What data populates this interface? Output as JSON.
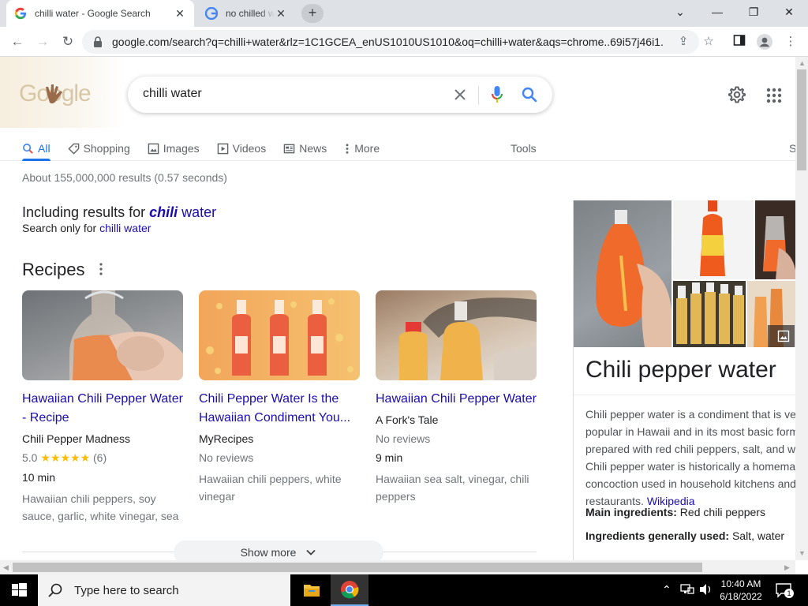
{
  "browser": {
    "tabs": [
      {
        "title": "chilli water - Google Search",
        "active": true
      },
      {
        "title": "no chilled water",
        "active": false
      }
    ],
    "url": "google.com/search?q=chilli+water&rlz=1C1GCEA_enUS1010US1010&oq=chilli+water&aqs=chrome..69i57j46i1..."
  },
  "header": {
    "doodle_text": "Google",
    "query": "chilli water"
  },
  "search_tabs": [
    {
      "label": "All",
      "icon": "search-icon",
      "active": true
    },
    {
      "label": "Shopping",
      "icon": "tag-icon",
      "active": false
    },
    {
      "label": "Images",
      "icon": "image-icon",
      "active": false
    },
    {
      "label": "Videos",
      "icon": "play-icon",
      "active": false
    },
    {
      "label": "News",
      "icon": "news-icon",
      "active": false
    },
    {
      "label": "More",
      "icon": "kebab-icon",
      "active": false
    }
  ],
  "tools_label": "Tools",
  "s_tab_label": "S",
  "result_stats": "About 155,000,000 results (0.57 seconds)",
  "spelling": {
    "prefix": "Including results for ",
    "corrected_bold": "chili",
    "corrected_rest": " water",
    "only_prefix": "Search only for ",
    "only_link": "chilli water"
  },
  "recipes": {
    "title": "Recipes",
    "cards": [
      {
        "title": "Hawaiian Chili Pepper Water - Recipe",
        "source": "Chili Pepper Madness",
        "rating": "5.0",
        "stars": "★★★★★",
        "reviews": "(6)",
        "time": "10 min",
        "ingredients": "Hawaiian chili peppers, soy sauce, garlic, white vinegar, sea"
      },
      {
        "title": "Chili Pepper Water Is the Hawaiian Condiment You...",
        "source": "MyRecipes",
        "rating_text": "No reviews",
        "ingredients": "Hawaiian chili peppers, white vinegar"
      },
      {
        "title": "Hawaiian Chili Pepper Water",
        "source": "A Fork's Tale",
        "rating_text": "No reviews",
        "time": "9 min",
        "ingredients": "Hawaiian sea salt, vinegar, chili peppers"
      }
    ],
    "show_more": "Show more"
  },
  "knowledge_panel": {
    "title": "Chili pepper water",
    "description": "Chili pepper water is a condiment that is very popular in Hawaii and in its most basic form is prepared with red chili peppers, salt, and water. Chili pepper water is historically a homemade concoction used in household kitchens and restaurants.",
    "wiki_link": "Wikipedia",
    "facts": [
      {
        "label": "Main ingredients:",
        "value": " Red chili peppers"
      },
      {
        "label": "Ingredients generally used:",
        "value": " Salt, water"
      }
    ]
  },
  "taskbar": {
    "search_placeholder": "Type here to search",
    "time": "10:40 AM",
    "date": "6/18/2022",
    "notification_count": "1"
  },
  "colors": {
    "link": "#1a0dab",
    "accent": "#1a73e8",
    "star": "#fbbc04"
  }
}
